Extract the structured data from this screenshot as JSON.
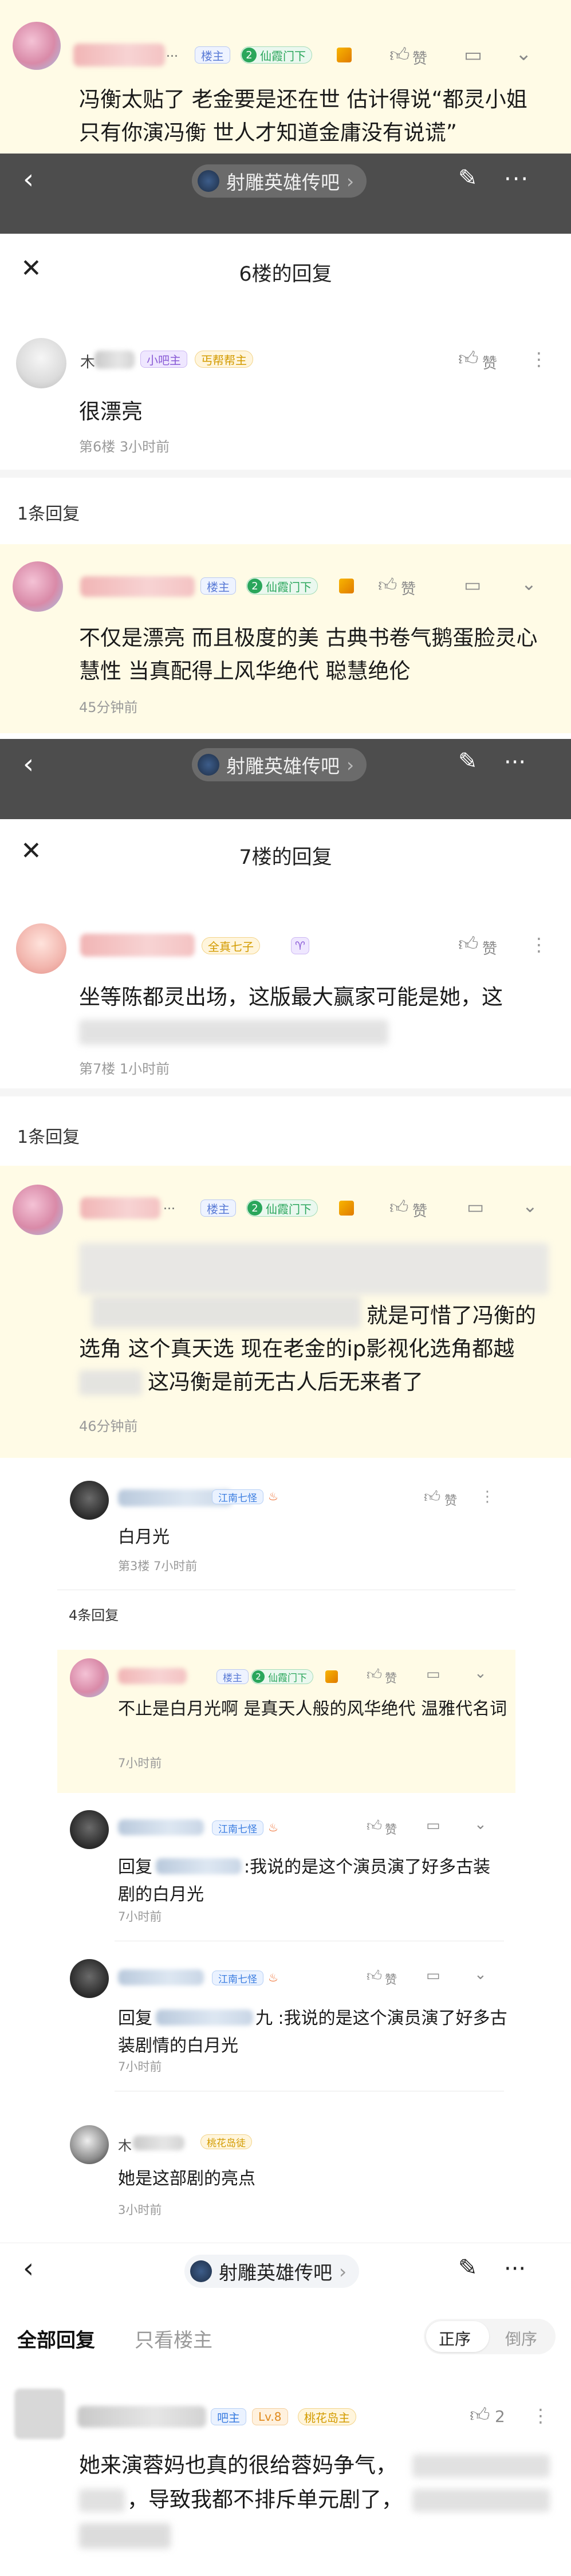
{
  "top_post": {
    "reply_text": "冯衡太贴了 老金要是还在世 估计得说“都灵小姐 只有你演冯衡 世人才知道金庸没有说谎”",
    "badges": {
      "louzhu": "楼主",
      "level": "2",
      "title": "仙霞门下"
    },
    "like_label": "赞"
  },
  "navbar": {
    "back_icon": "back-arrow-icon",
    "forum_name": "射雕英雄传吧",
    "chevron": "›",
    "more": "···"
  },
  "modal1": {
    "title": "6楼的回复",
    "close_glyph": "✕",
    "main": {
      "name_partial": "木",
      "badges": {
        "admin": "小吧主",
        "title": "丐帮帮主"
      },
      "content": "很漂亮",
      "meta": "第6楼  3小时前",
      "like_label": "赞"
    },
    "count_label": "1条回复",
    "reply": {
      "badges": {
        "louzhu": "楼主",
        "level": "2",
        "title": "仙霞门下"
      },
      "content": "不仅是漂亮 而且极度的美 古典书卷气鹅蛋脸灵心慧性 当真配得上风华绝代 聪慧绝伦",
      "meta": "45分钟前",
      "like_label": "赞"
    }
  },
  "modal2": {
    "title": "7楼的回复",
    "close_glyph": "✕",
    "main": {
      "badges": {
        "title": "全真七子"
      },
      "content": "坐等陈都灵出场，这版最大赢家可能是她，这",
      "meta": "第7楼  1小时前",
      "like_label": "赞"
    },
    "count_label": "1条回复",
    "reply": {
      "badges": {
        "louzhu": "楼主",
        "level": "2",
        "title": "仙霞门下"
      },
      "content_line1": "就是可惜了冯衡的",
      "content_line2": "选角 这个真天选 现在老金的ip影视化选角都越",
      "content_line3": "这冯衡是前无古人后无来者了",
      "meta": "46分钟前",
      "like_label": "赞"
    }
  },
  "floor3": {
    "main": {
      "badges": {
        "rank": "江南七怪"
      },
      "content": "白月光",
      "meta": "第3楼  7小时前",
      "like_label": "赞"
    },
    "count_label": "4条回复",
    "replies": [
      {
        "type": "louzhu",
        "badges": {
          "louzhu": "楼主",
          "level": "2",
          "title": "仙霞门下"
        },
        "content": "不止是白月光啊 是真天人般的风华绝代 温雅代名词",
        "meta": "7小时前",
        "like_label": "赞"
      },
      {
        "type": "user",
        "badges": {
          "rank": "江南七怪"
        },
        "content_prefix": "回复",
        "content_rest": ":我说的是这个演员演了好多古装剧的白月光",
        "meta": "7小时前",
        "like_label": "赞"
      },
      {
        "type": "user",
        "badges": {
          "rank": "江南七怪"
        },
        "content_prefix": "回复",
        "content_rest": "九 :我说的是这个演员演了好多古装剧情的白月光",
        "meta": "7小时前",
        "like_label": "赞"
      },
      {
        "type": "user2",
        "name_partial": "木",
        "badges": {
          "rank": "桃花岛徒"
        },
        "content": "她是这部剧的亮点",
        "meta": "3小时前",
        "like_label": "赞"
      }
    ]
  },
  "bottom": {
    "tabs": {
      "all": "全部回复",
      "louzhu_only": "只看楼主"
    },
    "sort": {
      "asc": "正序",
      "desc": "倒序"
    },
    "post": {
      "badges": {
        "admin": "吧主",
        "level": "Lv.8",
        "title": "桃花岛主"
      },
      "like_count": "2",
      "content_line1": "她来演蓉妈也真的很给蓉妈争气，",
      "content_line2": "，导致我都不排斥单元剧了，"
    }
  }
}
